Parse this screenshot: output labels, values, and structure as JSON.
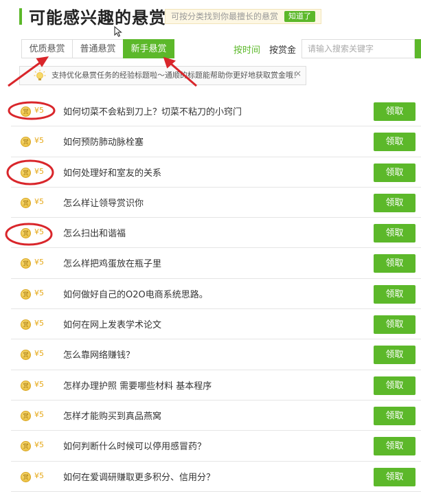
{
  "header": {
    "title": "可能感兴趣的悬赏",
    "hint": "可按分类找到你最擅长的悬赏",
    "hint_button": "知道了"
  },
  "tabs": [
    {
      "label": "优质悬赏"
    },
    {
      "label": "普通悬赏"
    },
    {
      "label": "新手悬赏"
    }
  ],
  "sort": {
    "by_time": "按时间",
    "by_reward": "按赏金"
  },
  "search": {
    "placeholder": "请输入搜索关键字"
  },
  "tip": {
    "text": "支持优化悬赏任务的经验标题啦～通顺的标题能帮助你更好地获取赏金哦！",
    "close": "×"
  },
  "coin_glyph": "赏",
  "claim_label": "领取",
  "colors": {
    "accent": "#5cb82a",
    "reward": "#e6a817",
    "annotation": "#d9262b"
  },
  "rewards": [
    {
      "amount": "¥5",
      "question": "如何切菜不会粘到刀上？切菜不粘刀的小窍门"
    },
    {
      "amount": "¥5",
      "question": "如何预防肺动脉栓塞"
    },
    {
      "amount": "¥5",
      "question": "如何处理好和室友的关系"
    },
    {
      "amount": "¥5",
      "question": "怎么样让领导赏识你"
    },
    {
      "amount": "¥5",
      "question": "怎么扫出和谐福"
    },
    {
      "amount": "¥5",
      "question": "怎么样把鸡蛋放在瓶子里"
    },
    {
      "amount": "¥5",
      "question": "如何做好自己的O2O电商系统思路。"
    },
    {
      "amount": "¥5",
      "question": "如何在网上发表学术论文"
    },
    {
      "amount": "¥5",
      "question": "怎么靠网络赚钱？"
    },
    {
      "amount": "¥5",
      "question": "怎样办理护照 需要哪些材料 基本程序"
    },
    {
      "amount": "¥5",
      "question": "怎样才能购买到真品燕窝"
    },
    {
      "amount": "¥5",
      "question": "如何判断什么时候可以停用感冒药？"
    },
    {
      "amount": "¥5",
      "question": "如何在爱调研赚取更多积分、信用分？"
    }
  ]
}
